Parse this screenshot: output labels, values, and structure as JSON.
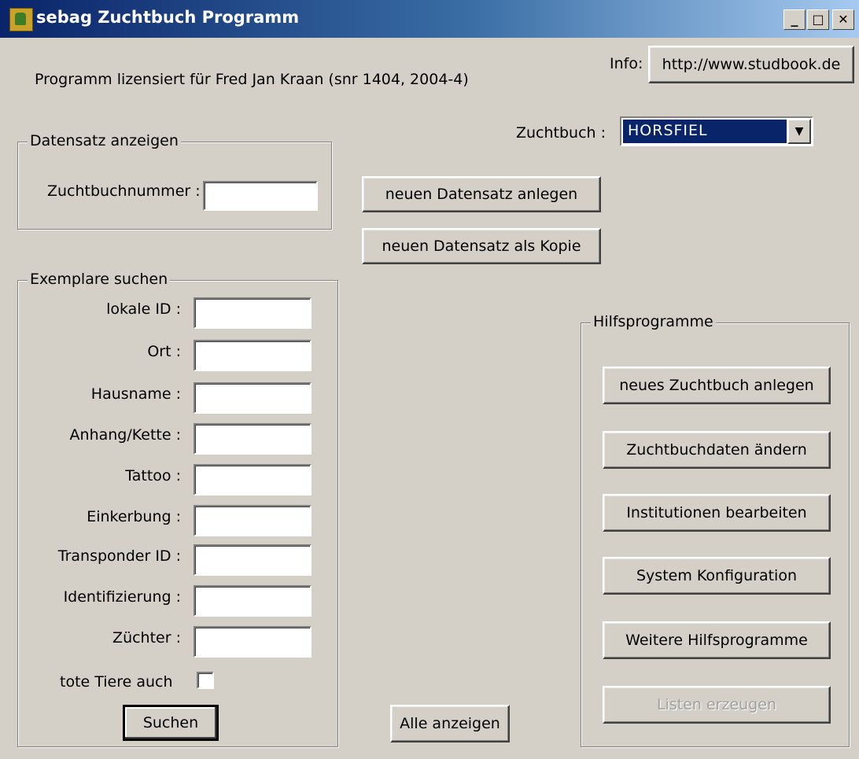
{
  "window": {
    "title": "sebag Zuchtbuch Programm",
    "controls": {
      "minimize": "_",
      "maximize": "□",
      "close": "✕"
    }
  },
  "info": {
    "label": "Info:",
    "button": "http://www.studbook.de"
  },
  "license": "Programm lizensiert für Fred Jan Kraan  (snr 1404, 2004-4)",
  "zuchtbuch": {
    "label": "Zuchtbuch :",
    "selected": "HORSFIEL"
  },
  "datensatz": {
    "group_title": "Datensatz anzeigen",
    "label": "Zuchtbuchnummer :",
    "value": ""
  },
  "actions": {
    "new_record": "neuen Datensatz anlegen",
    "new_copy": "neuen Datensatz als Kopie",
    "show_all": "Alle anzeigen"
  },
  "search": {
    "group_title": "Exemplare suchen",
    "fields": [
      {
        "label": "lokale ID :",
        "value": ""
      },
      {
        "label": "Ort :",
        "value": ""
      },
      {
        "label": "Hausname :",
        "value": ""
      },
      {
        "label": "Anhang/Kette :",
        "value": ""
      },
      {
        "label": "Tattoo :",
        "value": ""
      },
      {
        "label": "Einkerbung :",
        "value": ""
      },
      {
        "label": "Transponder ID :",
        "value": ""
      },
      {
        "label": "Identifizierung :",
        "value": ""
      },
      {
        "label": "Züchter :",
        "value": ""
      }
    ],
    "dead_animals_label": "tote Tiere auch",
    "dead_animals_checked": false,
    "search_button": "Suchen"
  },
  "tools": {
    "group_title": "Hilfsprogramme",
    "buttons": [
      {
        "label": "neues Zuchtbuch anlegen",
        "enabled": true
      },
      {
        "label": "Zuchtbuchdaten ändern",
        "enabled": true
      },
      {
        "label": "Institutionen bearbeiten",
        "enabled": true
      },
      {
        "label": "System Konfiguration",
        "enabled": true
      },
      {
        "label": "Weitere Hilfsprogramme",
        "enabled": true
      },
      {
        "label": "Listen erzeugen",
        "enabled": false
      }
    ]
  },
  "colors": {
    "face": "#d4d0c8",
    "titlebar_start": "#0a246a",
    "selection": "#0a246a"
  }
}
